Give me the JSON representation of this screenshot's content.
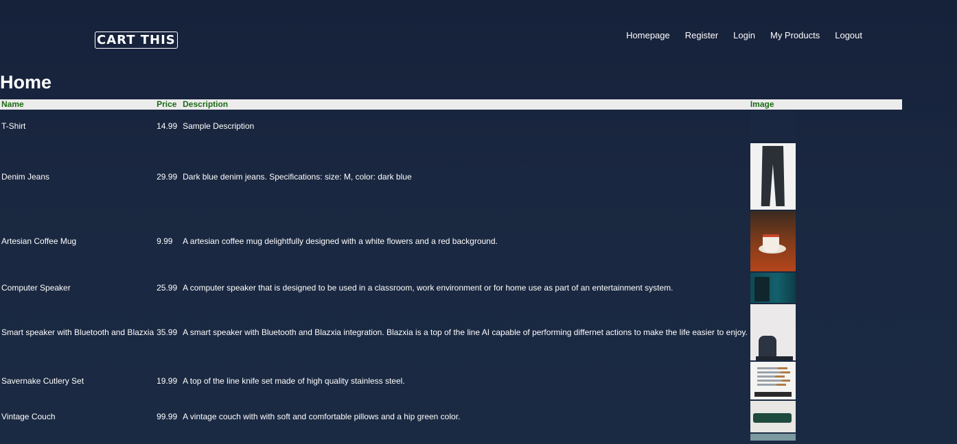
{
  "header": {
    "logo": "CART THIS",
    "nav": [
      "Homepage",
      "Register",
      "Login",
      "My Products",
      "Logout"
    ]
  },
  "page": {
    "title": "Home"
  },
  "table": {
    "columns": [
      "Name",
      "Price",
      "Description",
      "Image"
    ],
    "rows": [
      {
        "name": "T-Shirt",
        "price": "14.99",
        "description": "Sample Description",
        "image": "blank-image"
      },
      {
        "name": "Denim Jeans",
        "price": "29.99",
        "description": "Dark blue denim jeans. Specifications: size: M, color: dark blue",
        "image": "jeans-photo"
      },
      {
        "name": "Artesian Coffee Mug",
        "price": "9.99",
        "description": "A artesian coffee mug delightfully designed with a white flowers and a red background.",
        "image": "coffee-mug-photo"
      },
      {
        "name": "Computer Speaker",
        "price": "25.99",
        "description": "A computer speaker that is designed to be used in a classroom, work environment or for home use as part of an entertainment system.",
        "image": "computer-speaker-photo"
      },
      {
        "name": "Smart speaker with Bluetooth and Blazxia",
        "price": "35.99",
        "description": "A smart speaker with Bluetooth and Blazxia integration. Blazxia is a top of the line AI capable of performing differnet actions to make the life easier to enjoy.",
        "image": "smart-speaker-photo"
      },
      {
        "name": "Savernake Cutlery Set",
        "price": "19.99",
        "description": "A top of the line knife set made of high quality stainless steel.",
        "image": "cutlery-set-photo"
      },
      {
        "name": "Vintage Couch",
        "price": "99.99",
        "description": "A vintage couch with with soft and comfortable pillows and a hip green color.",
        "image": "couch-photo"
      }
    ]
  },
  "colors": {
    "background": "#172238",
    "header_row": "#ececec",
    "header_text": "#1a6b15"
  }
}
